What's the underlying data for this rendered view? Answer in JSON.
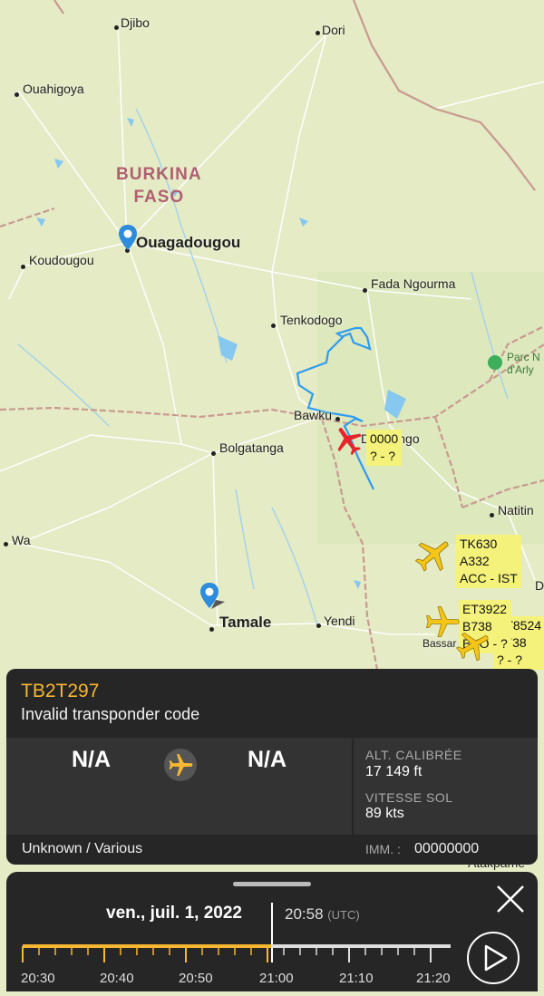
{
  "map": {
    "country": "BURKINA\nFASO",
    "cities": {
      "djibo": "Djibo",
      "dori": "Dori",
      "ouahigoya": "Ouahigoya",
      "ouagadougou": "Ouagadougou",
      "koudougou": "Koudougou",
      "fada": "Fada Ngourma",
      "tenkodogo": "Tenkodogo",
      "bawku": "Bawku",
      "dapaongo": "Dapaongo",
      "bolgatanga": "Bolgatanga",
      "natitingou": "Natitin",
      "wa": "Wa",
      "tamale": "Tamale",
      "yendi": "Yendi",
      "bassar": "Bassar",
      "atakpame": "Atakpame",
      "d_edge": "D"
    },
    "park": "Parc N\nd'Arly",
    "flight_labels": {
      "selected": "0000\n? - ?",
      "tk630": "TK630\nA332\nACC - IST",
      "et3922": "ET3922\nB738\nBKO - ?",
      "et8524": "ET8524\nB738\n? - ?"
    }
  },
  "card": {
    "callsign": "TB2T297",
    "status": "Invalid transponder code",
    "origin": "N/A",
    "destination": "N/A",
    "alt_label": "ALT. CALIBRÉE",
    "alt_value": "17 149 ft",
    "speed_label": "VITESSE SOL",
    "speed_value": "89 kts",
    "aircraft": "Unknown / Various",
    "reg_label": "IMM. :",
    "reg_value": "00000000"
  },
  "timeline": {
    "date": "ven., juil. 1, 2022",
    "time": "20:58",
    "tz": "(UTC)",
    "ticks": [
      "20:30",
      "20:40",
      "20:50",
      "21:00",
      "21:10",
      "21:20"
    ]
  },
  "colors": {
    "accent": "#f7b731",
    "track": "#2f9cf0",
    "selected_plane": "#e8232a",
    "other_plane": "#f5c518",
    "label_bg": "#f4f27a"
  }
}
